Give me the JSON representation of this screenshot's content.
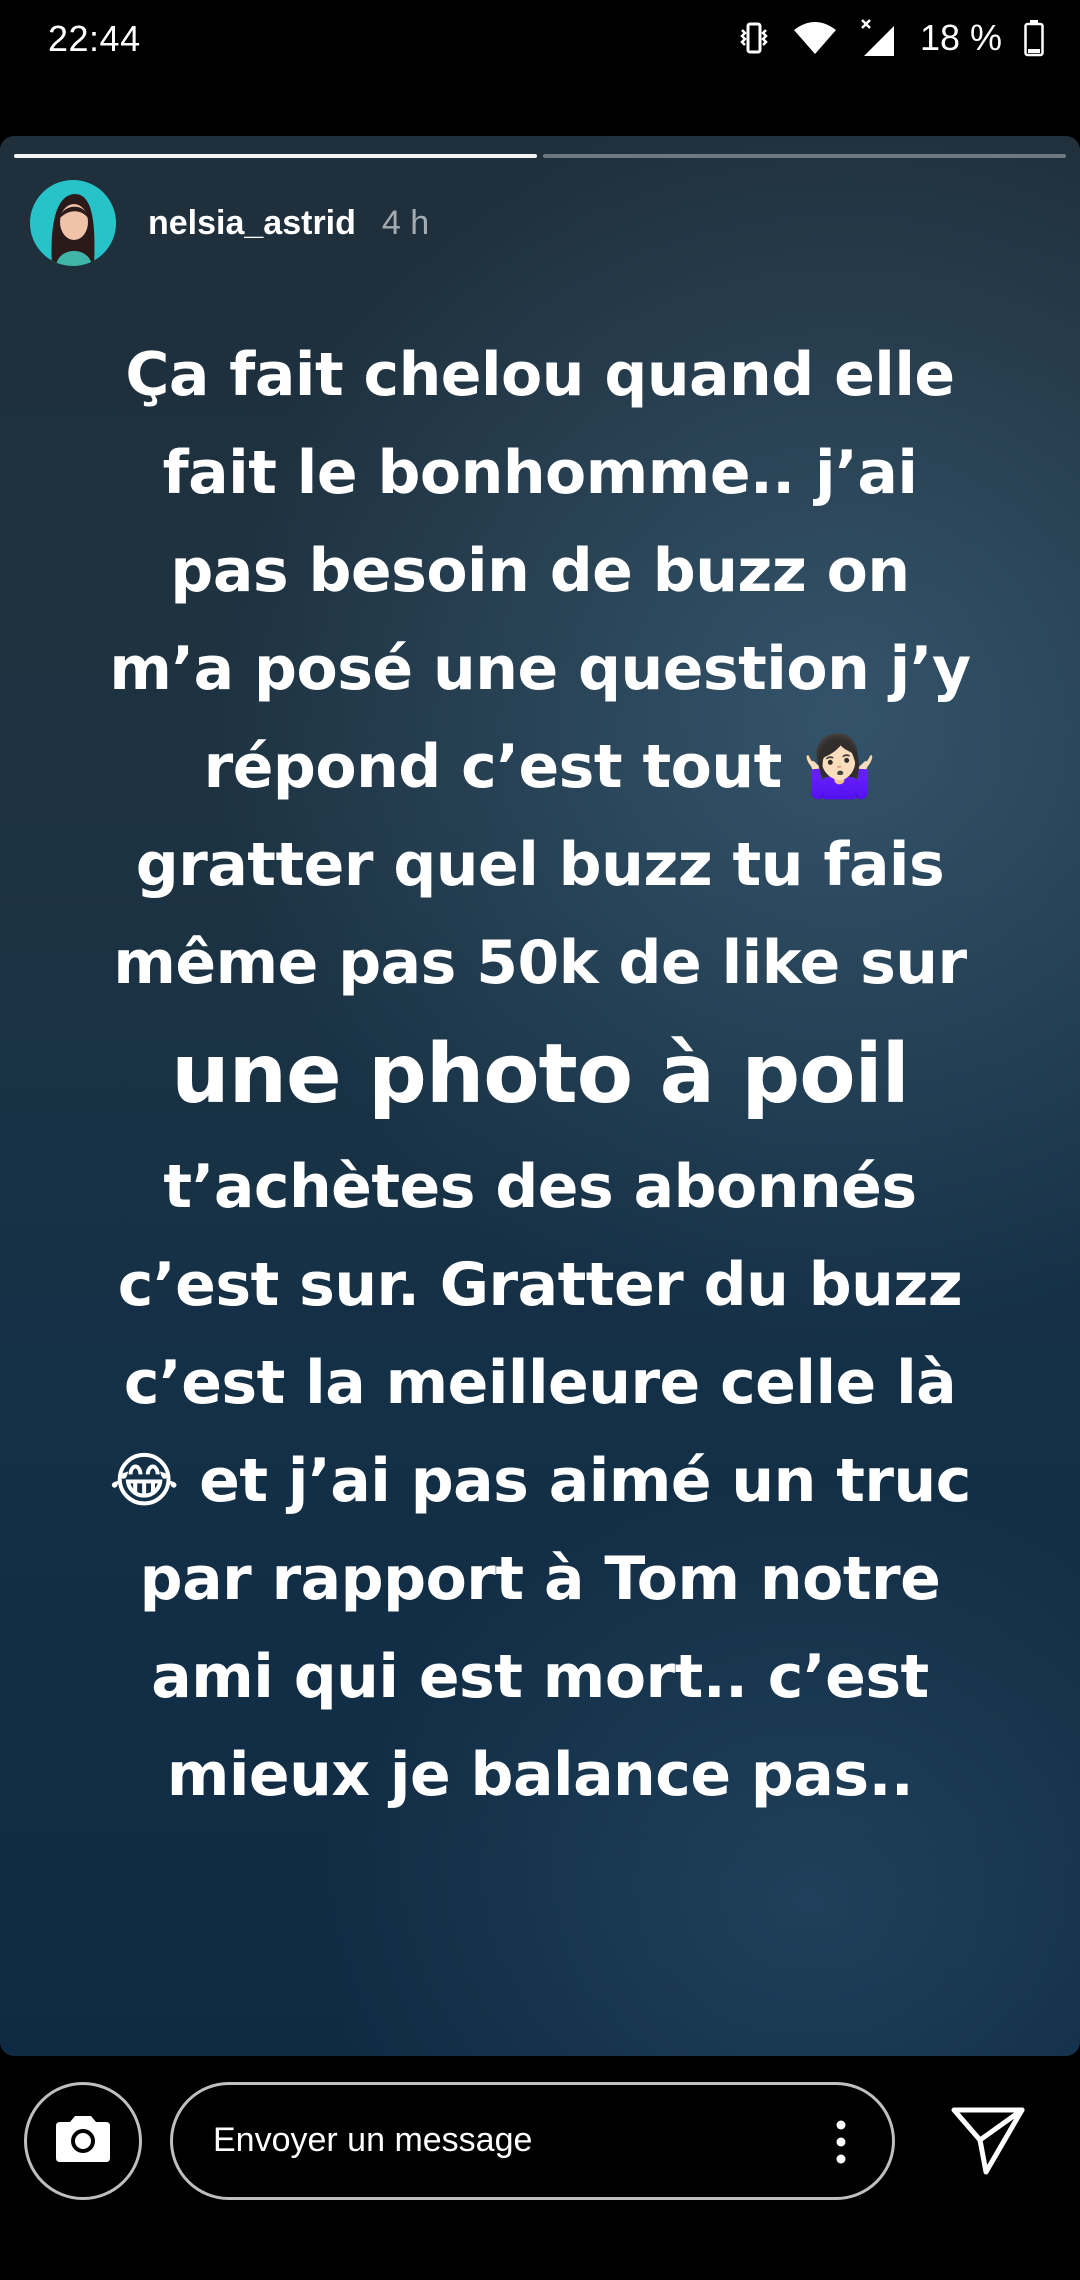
{
  "status_bar": {
    "time": "22:44",
    "battery_percent": "18 %",
    "icons": [
      "vibrate-icon",
      "wifi-icon",
      "cellular-no-data-icon",
      "battery-icon"
    ]
  },
  "story": {
    "segments_total": 2,
    "segments_done": 1,
    "username": "nelsia_astrid",
    "posted_ago": "4 h",
    "lines": [
      "Ça fait chelou quand elle",
      "fait le bonhomme.. j’ai",
      "pas besoin de buzz on",
      "m’a posé une question j’y",
      "répond c’est tout 🤷🏻‍♀️",
      "gratter quel buzz tu fais",
      "même pas 50k de like sur",
      "une photo à poil",
      "t’achètes des abonnés",
      "c’est sur. Gratter du buzz",
      "c’est la meilleure celle là",
      "😂 et j’ai pas aimé un truc",
      "par rapport à Tom notre",
      "ami qui est mort.. c’est",
      "mieux je balance pas.."
    ]
  },
  "bottom_bar": {
    "message_placeholder": "Envoyer un message",
    "icons": [
      "camera-icon",
      "more-vertical-icon",
      "send-icon"
    ]
  }
}
